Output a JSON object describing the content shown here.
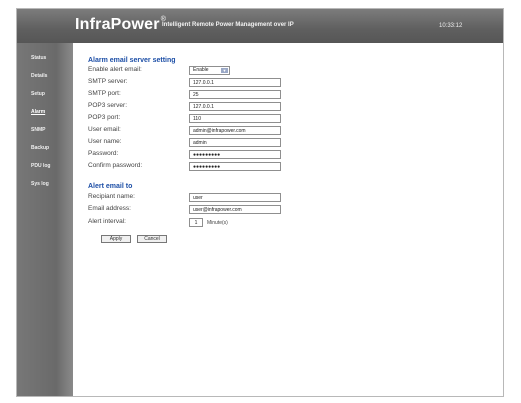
{
  "header": {
    "brand": "InfraPower",
    "trademark": "®",
    "tagline": "Intelligent Remote Power Management over IP",
    "clock": "10:33:12"
  },
  "sidebar": {
    "items": [
      {
        "label": "Status"
      },
      {
        "label": "Details"
      },
      {
        "label": "Setup"
      },
      {
        "label": "Alarm"
      },
      {
        "label": "SNMP"
      },
      {
        "label": "Backup"
      },
      {
        "label": "PDU log"
      },
      {
        "label": "Sys log"
      }
    ],
    "active": "Alarm"
  },
  "server": {
    "title": "Alarm email server setting",
    "enable_label": "Enable alert email:",
    "enable_value": "Enable",
    "smtp_server_label": "SMTP server:",
    "smtp_server_value": "127.0.0.1",
    "smtp_port_label": "SMTP port:",
    "smtp_port_value": "25",
    "pop3_server_label": "POP3 server:",
    "pop3_server_value": "127.0.0.1",
    "pop3_port_label": "POP3 port:",
    "pop3_port_value": "110",
    "user_email_label": "User email:",
    "user_email_value": "admin@infrapower.com",
    "user_name_label": "User name:",
    "user_name_value": "admin",
    "password_label": "Password:",
    "password_value": "●●●●●●●●●",
    "confirm_label": "Confirm password:",
    "confirm_value": "●●●●●●●●●"
  },
  "alert": {
    "title": "Alert email to",
    "recipient_label": "Recipiant name:",
    "recipient_value": "user",
    "email_label": "Email address:",
    "email_value": "user@infrapower.com",
    "interval_label": "Alert interval:",
    "interval_value": "1",
    "interval_unit": "Minute(s)"
  },
  "buttons": {
    "apply": "Apply",
    "cancel": "Cancel"
  }
}
